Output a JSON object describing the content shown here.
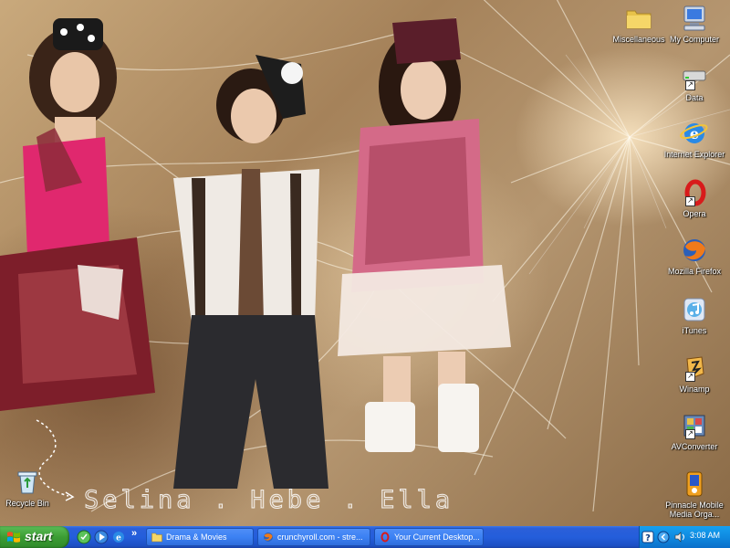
{
  "desktop": {
    "wallpaper_text": "Selina . Hebe . Ella",
    "icons": [
      {
        "label": "Miscellaneous",
        "icon": "folder-icon"
      },
      {
        "label": "My Computer",
        "icon": "computer-icon"
      },
      {
        "label": "Data",
        "icon": "drive-icon"
      },
      {
        "label": "Internet Explorer",
        "icon": "ie-icon"
      },
      {
        "label": "Opera",
        "icon": "opera-icon"
      },
      {
        "label": "Mozilla Firefox",
        "icon": "firefox-icon"
      },
      {
        "label": "iTunes",
        "icon": "itunes-icon"
      },
      {
        "label": "Winamp",
        "icon": "winamp-icon"
      },
      {
        "label": "AVConverter",
        "icon": "avconverter-icon"
      },
      {
        "label": "Pinnacle Mobile Media Orga...",
        "icon": "pinnacle-icon"
      },
      {
        "label": "Recycle Bin",
        "icon": "recycle-bin-icon"
      }
    ]
  },
  "taskbar": {
    "start_label": "start",
    "quick_launch_more": "»",
    "tasks": [
      {
        "label": "Drama & Movies",
        "icon": "folder-icon"
      },
      {
        "label": "crunchyroll.com - stre...",
        "icon": "firefox-icon"
      },
      {
        "label": "Your Current Desktop...",
        "icon": "opera-icon"
      }
    ],
    "clock": "3:08 AM",
    "colors": {
      "taskbar": "#245edb",
      "start": "#3c9d34",
      "tray": "#0f8ae0"
    }
  }
}
